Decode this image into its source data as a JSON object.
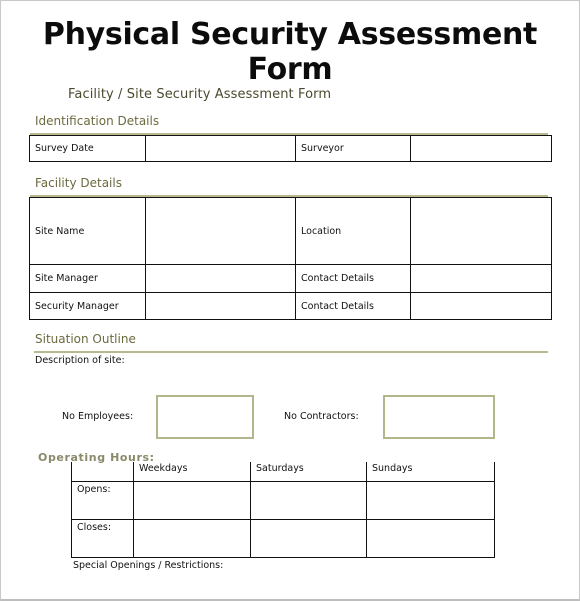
{
  "document": {
    "title": "Physical Security Assessment Form",
    "subtitle": "Facility / Site Security Assessment Form"
  },
  "identification": {
    "heading": "Identification Details",
    "row": {
      "label1": "Survey Date",
      "value1": "",
      "label2": "Surveyor",
      "value2": ""
    }
  },
  "facility": {
    "heading": "Facility Details",
    "rows": [
      {
        "label1": "Site Name",
        "value1": "",
        "label2": "Location",
        "value2": ""
      },
      {
        "label1": "Site Manager",
        "value1": "",
        "label2": "Contact Details",
        "value2": ""
      },
      {
        "label1": "Security Manager",
        "value1": "",
        "label2": "Contact Details",
        "value2": ""
      }
    ]
  },
  "situation": {
    "heading": "Situation Outline",
    "description_label": "Description of site:",
    "employees_label": "No Employees:",
    "employees_value": "",
    "contractors_label": "No Contractors:",
    "contractors_value": ""
  },
  "operating_hours": {
    "heading": "Operating Hours:",
    "columns": [
      "",
      "Weekdays",
      "Saturdays",
      "Sundays"
    ],
    "rows": [
      {
        "label": "Opens:",
        "values": [
          "",
          "",
          ""
        ]
      },
      {
        "label": "Closes:",
        "values": [
          "",
          "",
          ""
        ]
      }
    ],
    "special_label": "Special Openings / Restrictions:"
  },
  "colors": {
    "heading_text": "#6b6a3e",
    "rule": "#b8b98f",
    "box_border": "#b3b58a",
    "table_border": "#111111"
  }
}
